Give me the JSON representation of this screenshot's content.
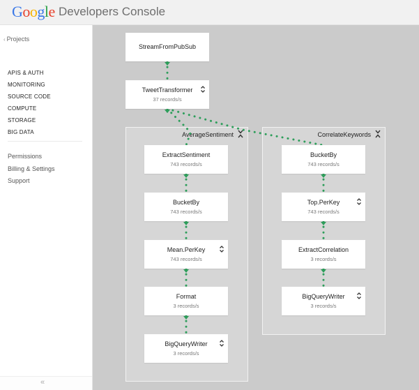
{
  "header": {
    "logo_letters": [
      {
        "ch": "G",
        "color": "#3b78e7"
      },
      {
        "ch": "o",
        "color": "#e8412c"
      },
      {
        "ch": "o",
        "color": "#f5b400"
      },
      {
        "ch": "g",
        "color": "#3b78e7"
      },
      {
        "ch": "l",
        "color": "#2ea24a"
      },
      {
        "ch": "e",
        "color": "#e8412c"
      }
    ],
    "title": "Developers Console"
  },
  "sidebar": {
    "back_chevron": "‹",
    "projects_label": "Projects",
    "primary_items": [
      {
        "label": "APIS & AUTH"
      },
      {
        "label": "MONITORING"
      },
      {
        "label": "SOURCE CODE"
      },
      {
        "label": "COMPUTE"
      },
      {
        "label": "STORAGE"
      },
      {
        "label": "BIG DATA"
      }
    ],
    "secondary_items": [
      {
        "label": "Permissions"
      },
      {
        "label": "Billing & Settings"
      },
      {
        "label": "Support"
      }
    ],
    "collapse_label": "«"
  },
  "pipeline": {
    "colors": {
      "edge": "#2e9e5b",
      "canvas": "#cbcbcb",
      "group": "#d6d6d6",
      "node": "#ffffff"
    },
    "top_nodes": [
      {
        "name": "StreamFromPubSub",
        "rate": "",
        "expandable": false
      },
      {
        "name": "TweetTransformer",
        "rate": "37 records/s",
        "expandable": true
      }
    ],
    "groups": [
      {
        "title": "AverageSentiment",
        "collapsible": true,
        "nodes": [
          {
            "name": "ExtractSentiment",
            "rate": "743 records/s",
            "expandable": false
          },
          {
            "name": "BucketBy",
            "rate": "743 records/s",
            "expandable": false
          },
          {
            "name": "Mean.PerKey",
            "rate": "743 records/s",
            "expandable": true
          },
          {
            "name": "Format",
            "rate": "3 records/s",
            "expandable": false
          },
          {
            "name": "BigQueryWriter",
            "rate": "3 records/s",
            "expandable": true
          }
        ]
      },
      {
        "title": "CorrelateKeywords",
        "collapsible": true,
        "nodes": [
          {
            "name": "BucketBy",
            "rate": "743 records/s",
            "expandable": false
          },
          {
            "name": "Top.PerKey",
            "rate": "743 records/s",
            "expandable": true
          },
          {
            "name": "ExtractCorrelation",
            "rate": "3 records/s",
            "expandable": false
          },
          {
            "name": "BigQueryWriter",
            "rate": "3 records/s",
            "expandable": true
          }
        ]
      }
    ]
  }
}
